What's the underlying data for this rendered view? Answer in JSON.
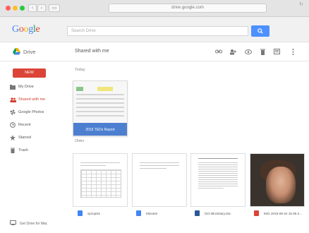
{
  "browser": {
    "url": "drive.google.com",
    "back_icon": "chevron-left-icon",
    "forward_icon": "chevron-right-icon"
  },
  "header": {
    "logo": "Google",
    "search_placeholder": "Search Drive"
  },
  "toolbar": {
    "app_name": "Drive",
    "section_title": "Shared with me"
  },
  "sidebar": {
    "new_label": "NEW",
    "items": [
      {
        "label": "My Drive",
        "icon": "folder-icon",
        "active": false
      },
      {
        "label": "Shared with me",
        "icon": "people-icon",
        "active": true
      },
      {
        "label": "Google Photos",
        "icon": "pinwheel-icon",
        "active": false
      },
      {
        "label": "Recent",
        "icon": "clock-icon",
        "active": false
      },
      {
        "label": "Starred",
        "icon": "star-icon",
        "active": false
      },
      {
        "label": "Trash",
        "icon": "trash-icon",
        "active": false
      }
    ],
    "get_drive": "Get Drive for Mac"
  },
  "main": {
    "today_label": "Today",
    "older_label": "Older",
    "today_file": {
      "name": "2015 TEDx Report"
    },
    "files": [
      {
        "name": "synopsis",
        "type": "doc"
      },
      {
        "name": "Minutes",
        "type": "doc"
      },
      {
        "name": "ISO Blockitary.doc",
        "type": "word"
      },
      {
        "name": "IMG 2015-08-24 15.09.3…",
        "type": "image"
      }
    ]
  },
  "colors": {
    "accent_red": "#db4437",
    "accent_blue": "#4d90fe",
    "caption_blue": "#4d7fd1"
  }
}
